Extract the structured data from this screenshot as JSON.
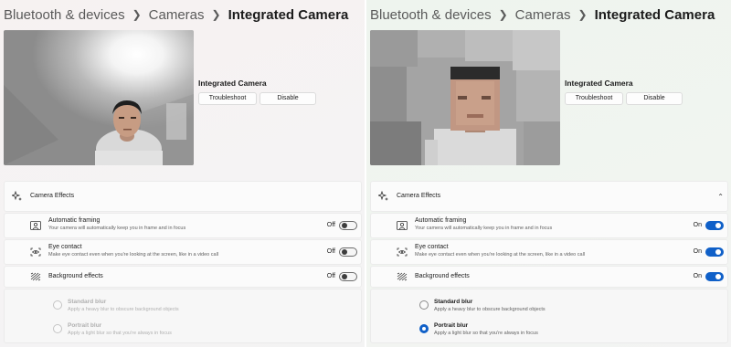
{
  "colors": {
    "accent": "#1060c8",
    "divider": "#ffffff"
  },
  "panels": [
    {
      "breadcrumb": [
        "Bluetooth & devices",
        "Cameras",
        "Integrated Camera"
      ],
      "camera_name": "Integrated Camera",
      "troubleshoot_label": "Troubleshoot",
      "disable_label": "Disable",
      "effects_title": "Camera Effects",
      "effects": [
        {
          "title": "Automatic framing",
          "description": "Your camera will automatically keep you in frame and in focus",
          "state": "Off",
          "icon": "framing-icon"
        },
        {
          "title": "Eye contact",
          "description": "Make eye contact even when you're looking at the screen, like in a video call",
          "state": "Off",
          "icon": "eye-contact-icon"
        },
        {
          "title": "Background effects",
          "state": "Off",
          "icon": "background-effects-icon"
        }
      ],
      "blur_options": [
        {
          "title": "Standard blur",
          "description": "Apply a heavy blur to obscure background objects",
          "selected": false
        },
        {
          "title": "Portrait blur",
          "description": "Apply a light blur so that you're always in focus",
          "selected": false
        }
      ]
    },
    {
      "breadcrumb": [
        "Bluetooth & devices",
        "Cameras",
        "Integrated Camera"
      ],
      "camera_name": "Integrated Camera",
      "troubleshoot_label": "Troubleshoot",
      "disable_label": "Disable",
      "effects_title": "Camera Effects",
      "effects": [
        {
          "title": "Automatic framing",
          "description": "Your camera will automatically keep you in frame and in focus",
          "state": "On",
          "icon": "framing-icon"
        },
        {
          "title": "Eye contact",
          "description": "Make eye contact even when you're looking at the screen, like in a video call",
          "state": "On",
          "icon": "eye-contact-icon"
        },
        {
          "title": "Background effects",
          "state": "On",
          "icon": "background-effects-icon"
        }
      ],
      "blur_options": [
        {
          "title": "Standard blur",
          "description": "Apply a heavy blur to obscure background objects",
          "selected": false
        },
        {
          "title": "Portrait blur",
          "description": "Apply a light blur so that you're always in focus",
          "selected": true
        }
      ]
    }
  ]
}
